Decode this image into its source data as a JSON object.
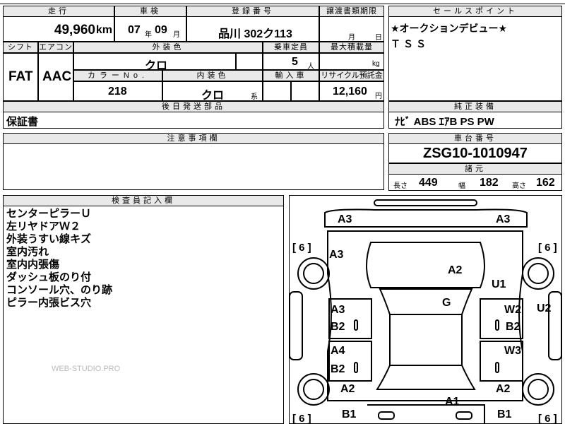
{
  "header_row": {
    "mileage_label": "走行",
    "inspection_label": "車検",
    "registration_label": "登録番号",
    "transfer_label": "譲渡書類期限",
    "sales_point_label": "セールスポイント"
  },
  "values": {
    "mileage": "49,960",
    "mileage_unit": "km",
    "inspection_year": "07",
    "year_unit": "年",
    "inspection_month": "09",
    "month_unit": "月",
    "registration": "品川 302ク113",
    "transfer_month_unit": "月",
    "transfer_day_unit": "日"
  },
  "row2": {
    "shift_label": "シフト",
    "ac_label": "エアコン",
    "exterior_color_label": "外装色",
    "capacity_label": "乗車定員",
    "max_load_label": "最大積載量",
    "shift": "FAT",
    "ac": "AAC",
    "exterior_color": "クロ",
    "capacity": "5",
    "capacity_unit": "人",
    "max_load_unit": "kg",
    "color_no_label": "カラーNo.",
    "interior_color_label": "内装色",
    "import_label": "輸入車",
    "recycle_label": "リサイクル預託金",
    "color_no": "218",
    "interior_color": "クロ",
    "interior_suffix": "系",
    "recycle_fee": "12,160",
    "yen_unit": "円"
  },
  "sales_points": [
    "★オークションデビュー★",
    "ＴＳＳ"
  ],
  "later_parts": {
    "label": "後日発送部品",
    "value": "保証書"
  },
  "equipment": {
    "label": "純正装備",
    "value": "ﾅﾋﾞ ABS ｴｱB PS PW"
  },
  "caution": {
    "label": "注意事項欄"
  },
  "chassis": {
    "label": "車台番号",
    "value": "ZSG10-1010947",
    "spec_label": "諸元",
    "length_label": "長さ",
    "length": "449",
    "width_label": "幅",
    "width": "182",
    "height_label": "高さ",
    "height": "162"
  },
  "inspector": {
    "label": "検査員記入欄",
    "notes": [
      "センターピラーＵ",
      "左リヤドアＷ２",
      "外装うすい線キズ",
      "室内汚れ",
      "室内内張傷",
      "ダッシュ板のり付",
      "コンソール穴、のり跡",
      "ピラー内張ビス穴"
    ],
    "watermark": "WEB-STUDIO.PRO"
  },
  "diagram": {
    "tire_counts": [
      "[ 6 ]",
      "[ 6 ]",
      "[ 6 ]",
      "[ 6 ]"
    ],
    "damage_codes": {
      "front_left": "A3",
      "front_right": "A3",
      "fender_left": "A3",
      "hood": "A2",
      "fender_right": "U1",
      "pillar_right": "U2",
      "roof": "G",
      "front_door_left_a": "A3",
      "front_door_left_b": "B2",
      "front_door_right_a": "W2",
      "front_door_right_b": "B2",
      "rear_door_left_a": "A4",
      "rear_door_left_b": "B2",
      "rear_door_right": "W3",
      "rear_fender_left": "A2",
      "rear_fender_right": "A2",
      "trunk": "A1",
      "rear_left": "B1",
      "rear_right": "B1"
    }
  }
}
